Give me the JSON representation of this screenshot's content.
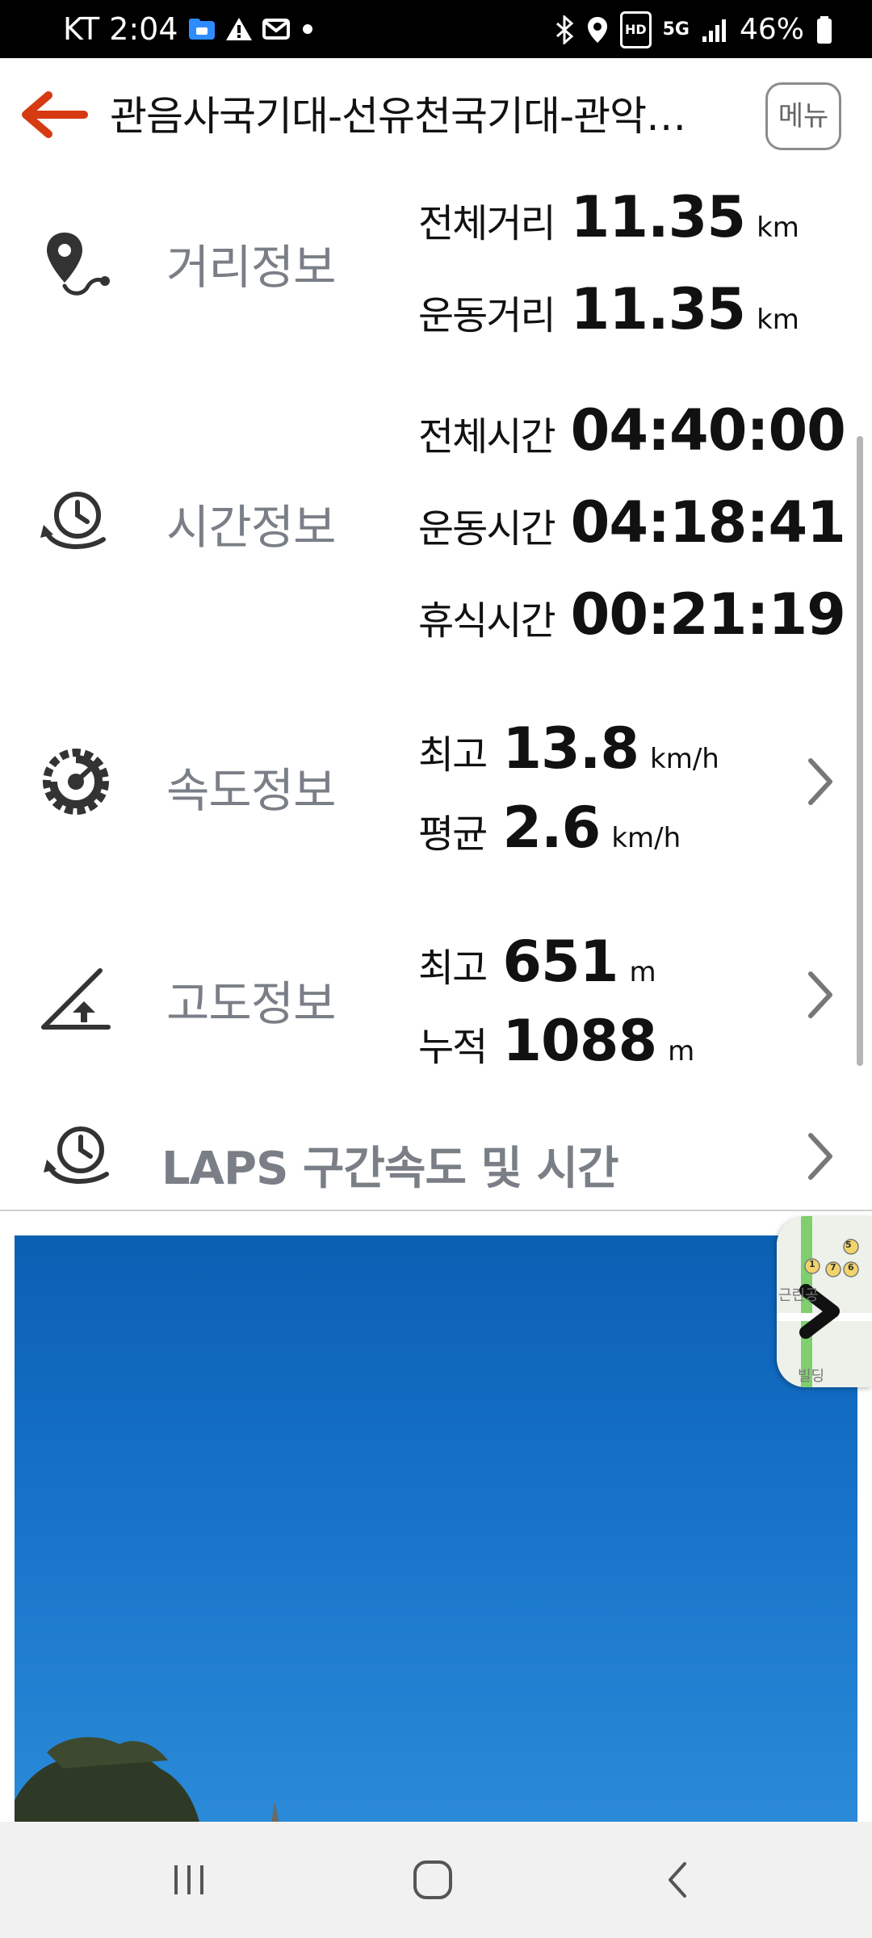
{
  "status_bar": {
    "carrier": "KT",
    "time": "2:04",
    "network": "5G",
    "battery": "46%",
    "hd_badge": "HD",
    "icons": [
      "folder-icon",
      "warning-icon",
      "mail-icon",
      "dot-icon",
      "bluetooth-icon",
      "location-icon",
      "hd-icon",
      "signal-icon",
      "battery-icon"
    ]
  },
  "header": {
    "title": "관음사국기대-선유천국기대-관악…",
    "menu_label": "메뉴",
    "back_icon": "back-arrow-icon",
    "accent_color": "#d63a12"
  },
  "distance": {
    "label": "거리정보",
    "stats": [
      {
        "key": "전체거리",
        "value": "11.35",
        "unit": "km"
      },
      {
        "key": "운동거리",
        "value": "11.35",
        "unit": "km"
      }
    ]
  },
  "time": {
    "label": "시간정보",
    "stats": [
      {
        "key": "전체시간",
        "value": "04:40:00"
      },
      {
        "key": "운동시간",
        "value": "04:18:41"
      },
      {
        "key": "휴식시간",
        "value": "00:21:19"
      }
    ]
  },
  "speed": {
    "label": "속도정보",
    "stats": [
      {
        "key": "최고",
        "value": "13.8",
        "unit": "km/h"
      },
      {
        "key": "평균",
        "value": "2.6",
        "unit": "km/h"
      }
    ]
  },
  "altitude": {
    "label": "고도정보",
    "stats": [
      {
        "key": "최고",
        "value": "651",
        "unit": "m"
      },
      {
        "key": "누적",
        "value": "1088",
        "unit": "m"
      }
    ]
  },
  "laps": {
    "label": "LAPS 구간속도 및 시간"
  },
  "map_thumbnail": {
    "labels": [
      "근린공",
      "빌딩"
    ],
    "markers": [
      "5",
      "1",
      "7",
      "6"
    ]
  },
  "nav": {
    "items": [
      "recent-apps-icon",
      "home-icon",
      "back-icon"
    ]
  }
}
